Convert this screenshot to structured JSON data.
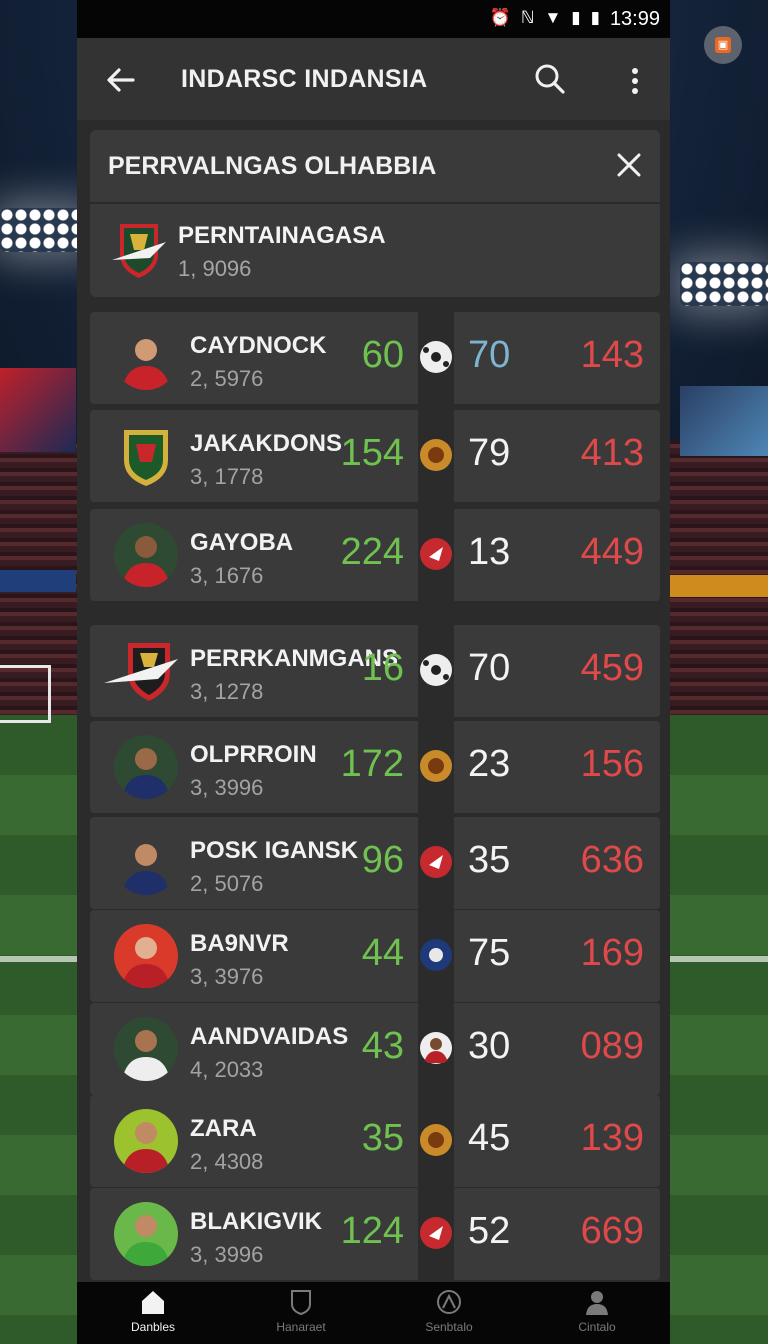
{
  "status_bar": {
    "time": "13:99"
  },
  "app_bar": {
    "title": "INDARSC INDANSIA"
  },
  "header_card": {
    "title": "PERRVALNGAS OLHABBIA",
    "team_name": "PERNTAINAGASA",
    "team_value": "1, 9096"
  },
  "rows": [
    {
      "name": "CAYDNOCK",
      "value": "2, 5976",
      "stat1": "60",
      "stat2": "70",
      "stat3": "143",
      "stat2_color": "#7fb4d0"
    },
    {
      "name": "JAKAKDONS",
      "value": "3, 1778",
      "stat1": "154",
      "stat2": "79",
      "stat3": "413"
    },
    {
      "name": "GAYOBA",
      "value": "3, 1676",
      "stat1": "224",
      "stat2": "13",
      "stat3": "449"
    },
    {
      "name": "PERRKANMGANS",
      "value": "3, 1278",
      "stat1": "16",
      "stat2": "70",
      "stat3": "459"
    },
    {
      "name": "OLPRROIN",
      "value": "3, 3996",
      "stat1": "172",
      "stat2": "23",
      "stat3": "156"
    },
    {
      "name": "POSK IGANSK",
      "value": "2, 5076",
      "stat1": "96",
      "stat2": "35",
      "stat3": "636"
    },
    {
      "name": "BA9NVR",
      "value": "3, 3976",
      "stat1": "44",
      "stat2": "75",
      "stat3": "169"
    },
    {
      "name": "AANDVAIDAS",
      "value": "4, 2033",
      "stat1": "43",
      "stat2": "30",
      "stat3": "089"
    },
    {
      "name": "ZARA",
      "value": "2, 4308",
      "stat1": "35",
      "stat2": "45",
      "stat3": "139"
    },
    {
      "name": "BLAKIGVIK",
      "value": "3, 3996",
      "stat1": "124",
      "stat2": "52",
      "stat3": "669"
    }
  ],
  "bottom_nav": [
    {
      "label": "Danbles",
      "icon": "home-icon",
      "active": true
    },
    {
      "label": "Hanaraet",
      "icon": "shield-icon",
      "active": false
    },
    {
      "label": "Senbtalo",
      "icon": "ball-icon",
      "active": false
    },
    {
      "label": "Cintalo",
      "icon": "person-icon",
      "active": false
    }
  ],
  "colors": {
    "positive": "#6fc250",
    "negative": "#e04949",
    "card": "#3a3a3b",
    "panel": "#2b2b2c"
  }
}
